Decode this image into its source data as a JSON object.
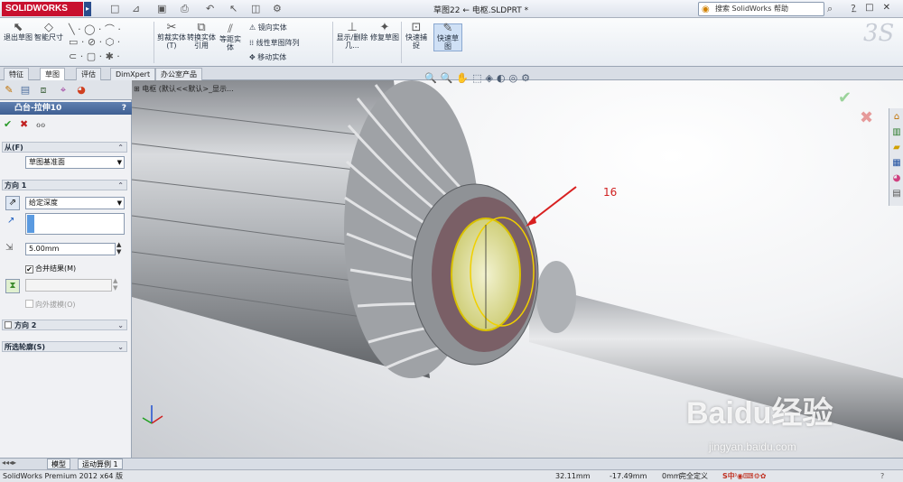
{
  "app": {
    "logo": "SOLIDWORKS",
    "window_title": "草图22 ← 电枢.SLDPRT *",
    "search_placeholder": "搜索 SolidWorks 帮助"
  },
  "ribbon": {
    "buttons": [
      {
        "id": "exit-sketch",
        "label": "退出草图"
      },
      {
        "id": "smart-dim",
        "label": "智能尺寸"
      },
      {
        "id": "trim",
        "label": "剪裁实体(T)"
      },
      {
        "id": "convert",
        "label": "转换实体引用"
      },
      {
        "id": "offset",
        "label": "等距实体"
      },
      {
        "id": "show-delete",
        "label": "显示/删除几..."
      },
      {
        "id": "repair",
        "label": "修复草图"
      },
      {
        "id": "quick-snap",
        "label": "快速捕捉"
      },
      {
        "id": "rapid-sketch",
        "label": "快速草图"
      }
    ],
    "small": [
      {
        "id": "mirror",
        "label": "镜向实体"
      },
      {
        "id": "linear-pattern",
        "label": "线性草图阵列"
      },
      {
        "id": "move",
        "label": "移动实体"
      }
    ]
  },
  "tabs": [
    "特征",
    "草图",
    "评估",
    "DimXpert",
    "办公室产品"
  ],
  "active_tab": "草图",
  "feature": {
    "title": "凸台-拉伸10",
    "help": "?",
    "from_label": "从(F)",
    "from_value": "草图基准面",
    "dir1_label": "方向 1",
    "end_condition": "给定深度",
    "depth": "5.00mm",
    "merge_label": "合并结果(M)",
    "draft_label": "向外拔模(O)",
    "dir2_label": "方向 2",
    "contours_label": "所选轮廓(S)"
  },
  "tree": {
    "label": "电枢 (默认<<默认>_显示..."
  },
  "annotation": "16",
  "bottom_tabs": [
    "模型",
    "运动算例 1"
  ],
  "status": {
    "product": "SolidWorks Premium 2012 x64 版",
    "x": "32.11mm",
    "y": "-17.49mm",
    "z": "0mm",
    "state": "完全定义"
  },
  "watermark": {
    "text": "Baidu经验",
    "url": "jingyan.baidu.com"
  }
}
